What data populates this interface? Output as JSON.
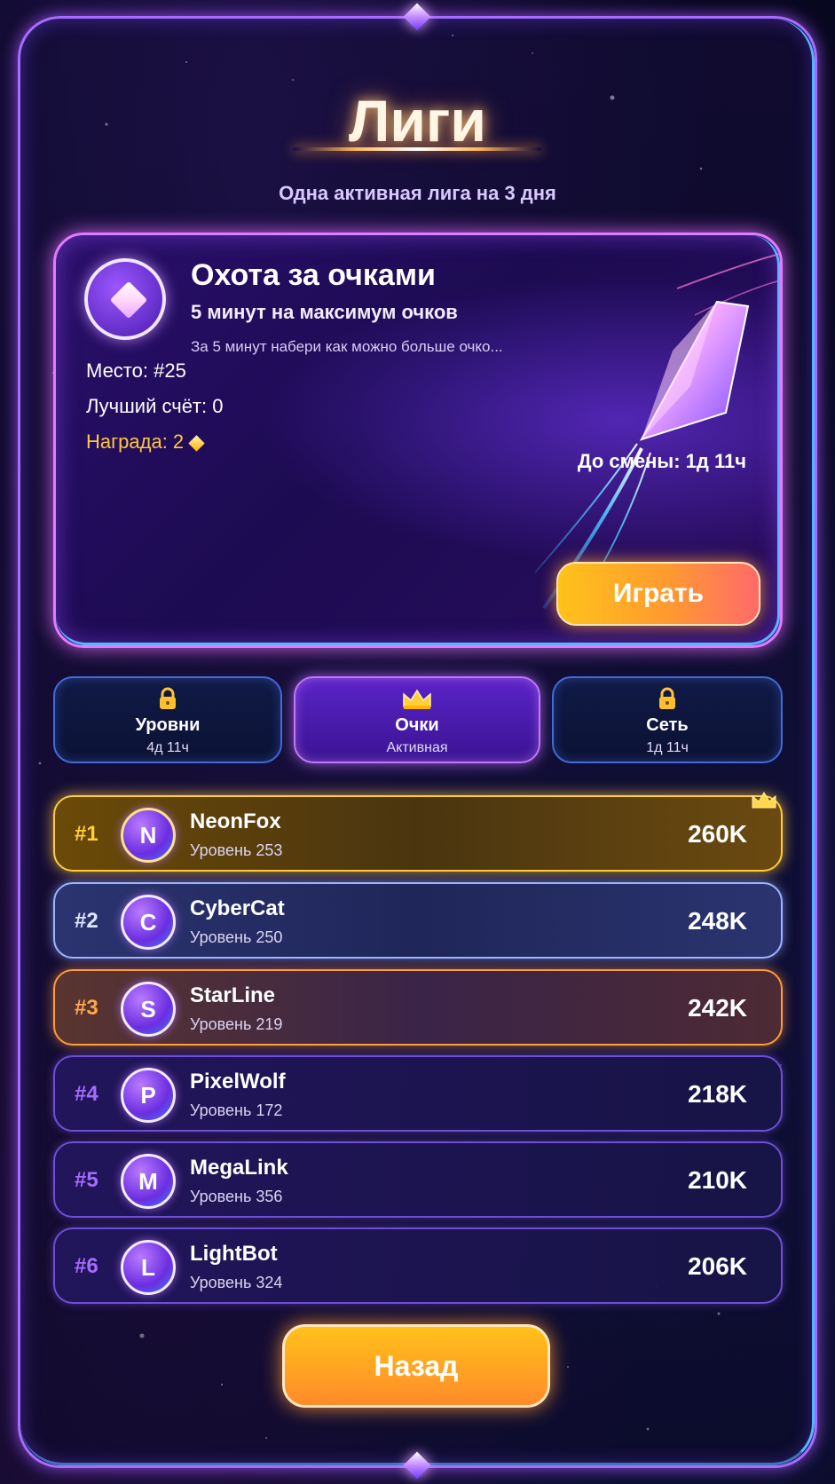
{
  "header": {
    "title": "Лиги",
    "subtitle": "Одна активная лига на 3 дня"
  },
  "league_card": {
    "icon": "diamond-gem-icon",
    "title": "Охота за очками",
    "subtitle": "5 минут на максимум очков",
    "description": "За 5 минут набери как можно больше очко...",
    "place": "Место: #25",
    "best_score": "Лучший счёт: 0",
    "reward": "Награда: 2",
    "reward_icon": "gold-gem-icon",
    "timer": "До смены: 1д 11ч",
    "play_label": "Играть"
  },
  "tabs": [
    {
      "label": "Уровни",
      "sub": "4д 11ч",
      "icon": "lock-icon",
      "active": false
    },
    {
      "label": "Очки",
      "sub": "Активная",
      "icon": "crown-icon",
      "active": true
    },
    {
      "label": "Сеть",
      "sub": "1д 11ч",
      "icon": "lock-icon",
      "active": false
    }
  ],
  "leaderboard": [
    {
      "rank": "#1",
      "initial": "N",
      "name": "NeonFox",
      "level": "Уровень 253",
      "score": "260K"
    },
    {
      "rank": "#2",
      "initial": "C",
      "name": "CyberCat",
      "level": "Уровень 250",
      "score": "248K"
    },
    {
      "rank": "#3",
      "initial": "S",
      "name": "StarLine",
      "level": "Уровень 219",
      "score": "242K"
    },
    {
      "rank": "#4",
      "initial": "P",
      "name": "PixelWolf",
      "level": "Уровень 172",
      "score": "218K"
    },
    {
      "rank": "#5",
      "initial": "M",
      "name": "MegaLink",
      "level": "Уровень 356",
      "score": "210K"
    },
    {
      "rank": "#6",
      "initial": "L",
      "name": "LightBot",
      "level": "Уровень 324",
      "score": "206K"
    }
  ],
  "footer": {
    "back_label": "Назад"
  },
  "colors": {
    "accent_purple": "#a86bff",
    "accent_blue": "#4fb6ff",
    "gold": "#ffcc3a",
    "button_orange": "#ff9a30"
  }
}
